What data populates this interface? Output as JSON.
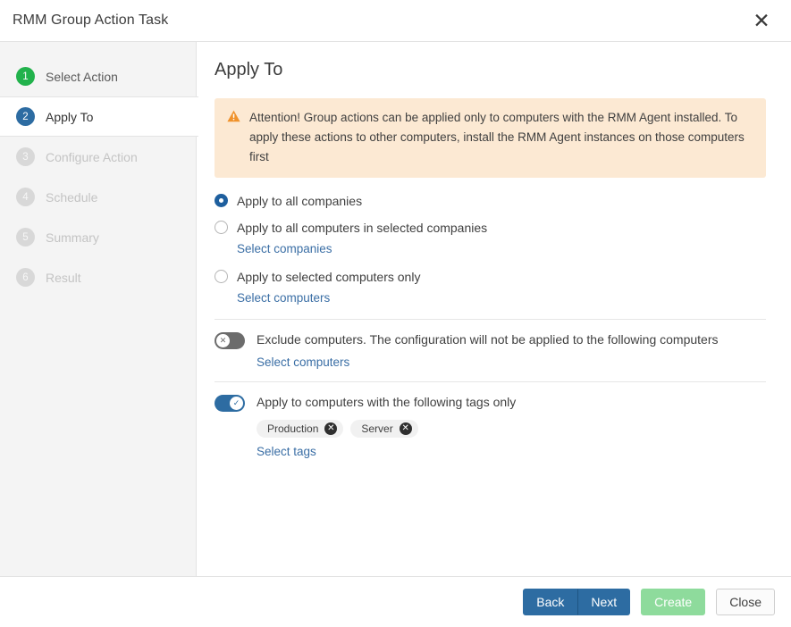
{
  "window": {
    "title": "RMM Group Action Task",
    "close_icon": "close-icon",
    "close_glyph": "✕"
  },
  "sidebar": {
    "steps": [
      {
        "num": "1",
        "label": "Select Action",
        "state": "done"
      },
      {
        "num": "2",
        "label": "Apply To",
        "state": "active"
      },
      {
        "num": "3",
        "label": "Configure Action",
        "state": "disabled"
      },
      {
        "num": "4",
        "label": "Schedule",
        "state": "disabled"
      },
      {
        "num": "5",
        "label": "Summary",
        "state": "disabled"
      },
      {
        "num": "6",
        "label": "Result",
        "state": "disabled"
      }
    ]
  },
  "main": {
    "page_title": "Apply To",
    "alert": {
      "icon": "warning-triangle-icon",
      "text": "Attention! Group actions can be applied only to computers with the RMM Agent installed. To apply these actions to other computers, install the RMM Agent instances on those computers first",
      "bg_color": "#fce9d3",
      "icon_color": "#f0922b"
    },
    "scope_options": [
      {
        "label": "Apply to all companies",
        "selected": true,
        "link": null
      },
      {
        "label": "Apply to all computers in selected companies",
        "selected": false,
        "link": "Select companies"
      },
      {
        "label": "Apply to selected computers only",
        "selected": false,
        "link": "Select computers"
      }
    ],
    "exclude": {
      "enabled": false,
      "label": "Exclude computers. The configuration will not be applied to the following computers",
      "link": "Select computers",
      "toggle_icon": "toggle-off-x-icon",
      "toggle_glyph": "✕"
    },
    "tags": {
      "enabled": true,
      "label": "Apply to computers with the following tags only",
      "link": "Select tags",
      "toggle_icon": "toggle-on-check-icon",
      "toggle_glyph": "✓",
      "items": [
        {
          "name": "Production",
          "remove_glyph": "✕"
        },
        {
          "name": "Server",
          "remove_glyph": "✕"
        }
      ]
    }
  },
  "footer": {
    "back_label": "Back",
    "next_label": "Next",
    "create_label": "Create",
    "close_label": "Close"
  },
  "colors": {
    "accent_blue": "#2d6ca2",
    "step_done_green": "#22b24c",
    "link_blue": "#3a6ea5",
    "create_green": "#8edb9c",
    "sidebar_bg": "#f4f4f4"
  }
}
